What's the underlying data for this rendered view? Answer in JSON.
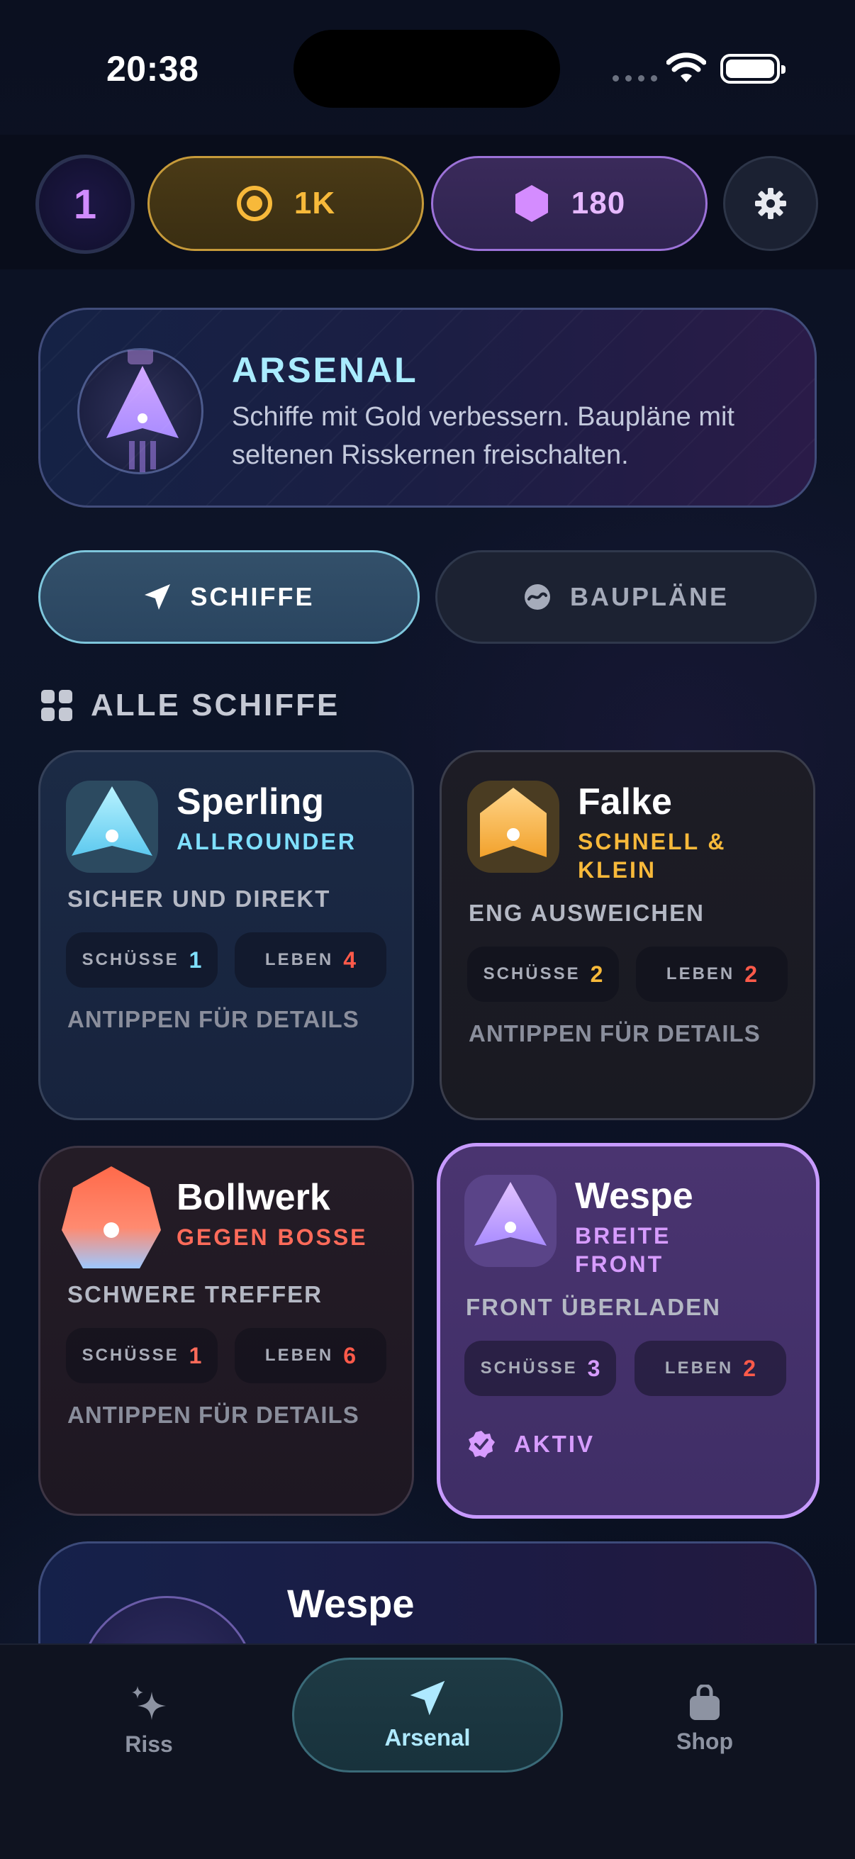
{
  "status_bar": {
    "time": "20:38"
  },
  "header": {
    "level": "1",
    "gold": "1K",
    "gems": "180",
    "icons": {
      "gold": "coin-icon",
      "gems": "hexagon-gem-icon",
      "settings": "gear-icon"
    }
  },
  "banner": {
    "title": "ARSENAL",
    "description": "Schiffe mit Gold verbessern. Baupläne mit seltenen Risskernen freischalten."
  },
  "tabs": {
    "ships": "SCHIFFE",
    "blueprints": "BAUPLÄNE",
    "selected": "ships"
  },
  "section": {
    "title": "ALLE SCHIFFE"
  },
  "stat_labels": {
    "shots": "SCHÜSSE",
    "lives": "LEBEN"
  },
  "ships": [
    {
      "name": "Sperling",
      "role": "ALLROUNDER",
      "tagline": "SICHER UND DIREKT",
      "shots": "1",
      "lives": "4",
      "hint": "ANTIPPEN FÜR DETAILS",
      "role_color": "#7fe0ff",
      "shots_color": "#7fe0ff"
    },
    {
      "name": "Falke",
      "role": "SCHNELL & KLEIN",
      "tagline": "ENG AUSWEICHEN",
      "shots": "2",
      "lives": "2",
      "hint": "ANTIPPEN FÜR DETAILS",
      "role_color": "#f7b93a",
      "shots_color": "#f7b93a"
    },
    {
      "name": "Bollwerk",
      "role": "GEGEN BOSSE",
      "tagline": "SCHWERE TREFFER",
      "shots": "1",
      "lives": "6",
      "hint": "ANTIPPEN FÜR DETAILS",
      "role_color": "#ff6b5a",
      "shots_color": "#ff6b5a"
    },
    {
      "name": "Wespe",
      "role": "BREITE FRONT",
      "tagline": "FRONT ÜBERLADEN",
      "shots": "3",
      "lives": "2",
      "active_label": "AKTIV",
      "role_color": "#d79cff",
      "shots_color": "#d79cff"
    }
  ],
  "lives_color": "#ff5a4a",
  "featured": {
    "name": "Wespe"
  },
  "tabbar": {
    "riss": "Riss",
    "arsenal": "Arsenal",
    "shop": "Shop",
    "selected": "arsenal"
  }
}
